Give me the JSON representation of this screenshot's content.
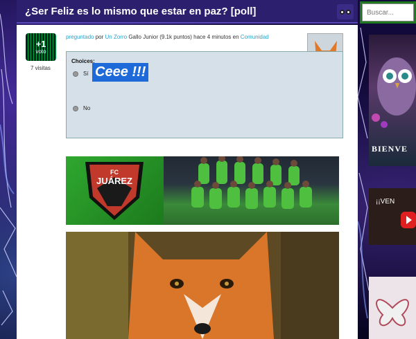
{
  "header": {
    "title": "¿Ser Feliz es lo mismo que estar en paz? [poll]"
  },
  "search": {
    "placeholder": "Buscar..."
  },
  "question": {
    "vote_count": "+1",
    "vote_label": "voto",
    "visits": "7 visitas",
    "asked_label": "preguntado",
    "by_label": "por",
    "author": "Un Zorro",
    "author_rank": "Gallo Junior (9.1k puntos)",
    "time": "hace 4 minutos",
    "in_label": "en",
    "category": "Comunidad"
  },
  "poll": {
    "heading": "Choices:",
    "options": [
      {
        "label": "Sí"
      },
      {
        "label": "No"
      }
    ],
    "sticker_text": "Ceee !!!"
  },
  "banner": {
    "crest_top": "FC",
    "crest_name": "JUÁREZ"
  },
  "sidebar": {
    "ad1_text": "BIENVE",
    "ad2_text": "¡¡VEN"
  }
}
